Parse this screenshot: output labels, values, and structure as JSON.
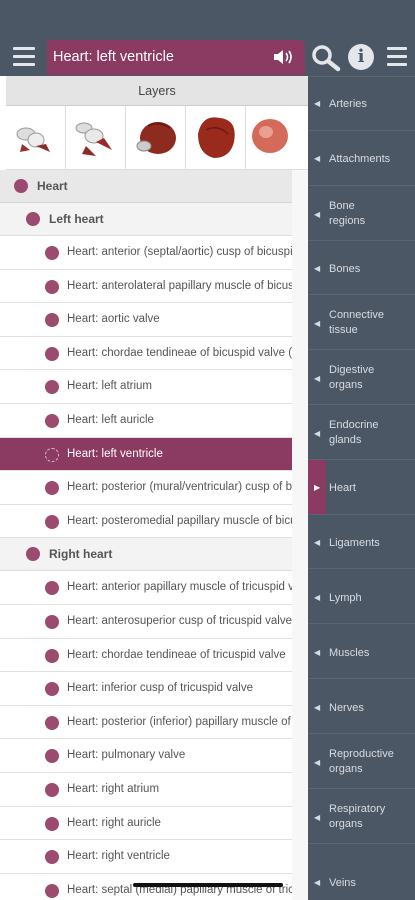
{
  "header": {
    "title": "Heart: left ventricle",
    "menu_icon": "hamburger-menu-icon",
    "speaker_icon": "speaker-icon",
    "search_icon": "search-icon",
    "info_icon": "info-icon",
    "info_glyph": "i",
    "right_menu_icon": "hamburger-menu-icon"
  },
  "layers": {
    "heading": "Layers",
    "thumbnails": [
      "layer-1",
      "layer-2",
      "layer-3",
      "layer-4",
      "layer-5"
    ]
  },
  "tree": {
    "root": "Heart",
    "groups": [
      {
        "label": "Left heart",
        "items": [
          "Heart: anterior (septal/aortic) cusp of bicuspid valve",
          "Heart: anterolateral papillary muscle of bicuspid valve",
          "Heart: aortic valve",
          "Heart: chordae tendineae of bicuspid valve (mitral)",
          "Heart: left atrium",
          "Heart: left auricle",
          "Heart: left ventricle",
          "Heart: posterior (mural/ventricular) cusp of bicuspid valve",
          "Heart: posteromedial papillary muscle of bicuspid valve"
        ]
      },
      {
        "label": "Right heart",
        "items": [
          "Heart: anterior papillary muscle of tricuspid valve",
          "Heart: anterosuperior cusp of tricuspid valve",
          "Heart: chordae tendineae of tricuspid valve",
          "Heart: inferior cusp of tricuspid valve",
          "Heart: posterior (inferior) papillary muscle of tricuspid valve",
          "Heart: pulmonary valve",
          "Heart: right atrium",
          "Heart: right auricle",
          "Heart: right ventricle",
          "Heart: septal (medial) papillary muscle of tricuspid valve"
        ]
      }
    ],
    "selected": "Heart: left ventricle"
  },
  "categories": [
    "Arteries",
    "Attachments",
    "Bone regions",
    "Bones",
    "Connective tissue",
    "Digestive organs",
    "Endocrine glands",
    "Heart",
    "Ligaments",
    "Lymph",
    "Muscles",
    "Nerves",
    "Reproductive organs",
    "Respiratory organs",
    "Veins"
  ],
  "active_category": "Heart",
  "colors": {
    "accent": "#8b3a62",
    "sidebar": "#4c5765",
    "dot": "#9b4a70"
  }
}
